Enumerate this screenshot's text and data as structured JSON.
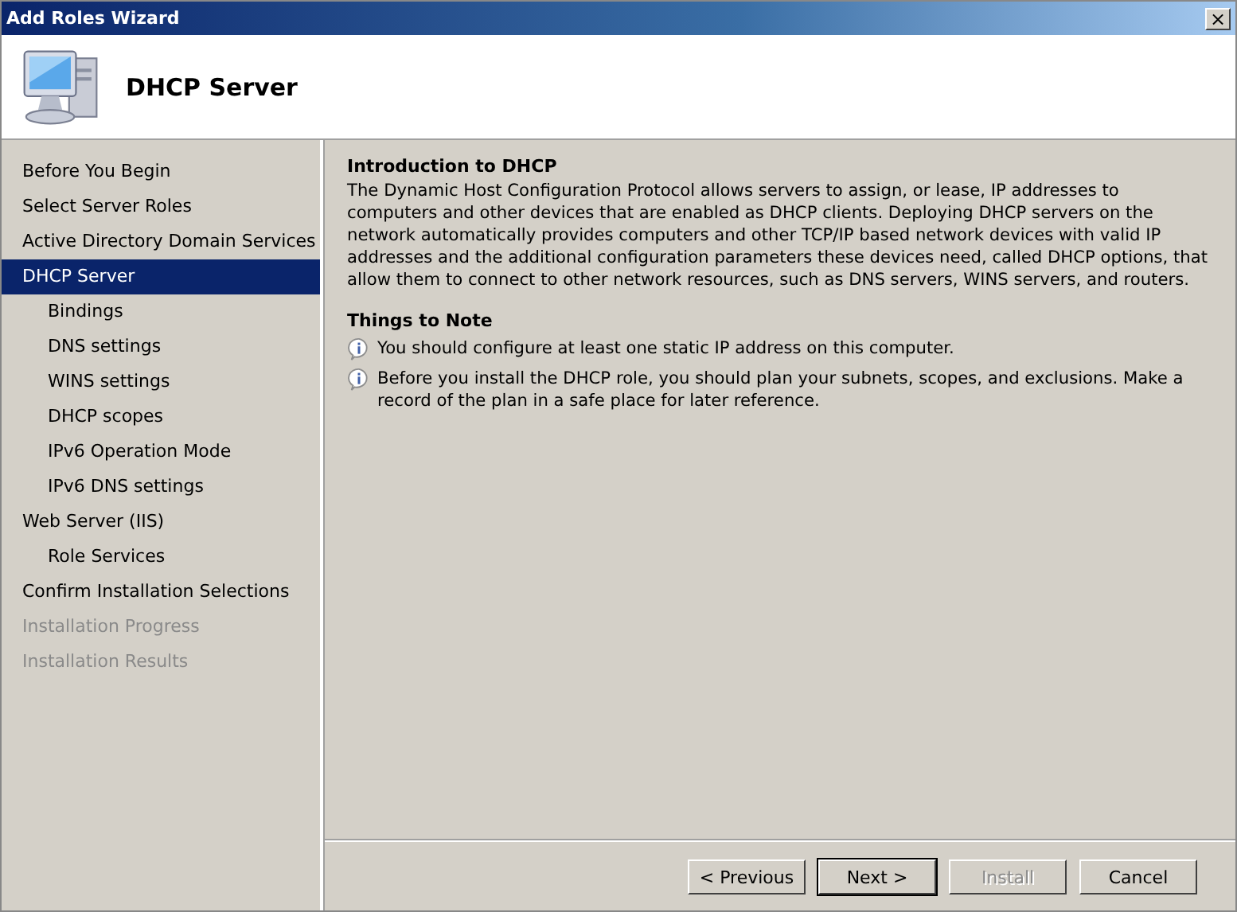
{
  "window": {
    "title": "Add Roles Wizard",
    "close": "×"
  },
  "header": {
    "title": "DHCP Server"
  },
  "steps": [
    {
      "label": "Before You Begin",
      "selected": false,
      "disabled": false
    },
    {
      "label": "Select Server Roles",
      "selected": false,
      "disabled": false
    },
    {
      "label": "Active Directory Domain Services",
      "selected": false,
      "disabled": false
    },
    {
      "label": "DHCP Server",
      "selected": true,
      "disabled": false,
      "children": [
        {
          "label": "Bindings",
          "selected": false,
          "disabled": false
        },
        {
          "label": "DNS settings",
          "selected": false,
          "disabled": false
        },
        {
          "label": "WINS settings",
          "selected": false,
          "disabled": false
        },
        {
          "label": "DHCP scopes",
          "selected": false,
          "disabled": false
        },
        {
          "label": "IPv6 Operation Mode",
          "selected": false,
          "disabled": false
        },
        {
          "label": "IPv6 DNS settings",
          "selected": false,
          "disabled": false
        }
      ]
    },
    {
      "label": "Web Server (IIS)",
      "selected": false,
      "disabled": false,
      "children": [
        {
          "label": "Role Services",
          "selected": false,
          "disabled": false
        }
      ]
    },
    {
      "label": "Confirm Installation Selections",
      "selected": false,
      "disabled": false
    },
    {
      "label": "Installation Progress",
      "selected": false,
      "disabled": true
    },
    {
      "label": "Installation Results",
      "selected": false,
      "disabled": true
    }
  ],
  "content": {
    "intro_heading": "Introduction to DHCP",
    "intro_text": "The Dynamic Host Configuration Protocol allows servers to assign, or lease, IP addresses to computers and other devices that are enabled as DHCP clients. Deploying DHCP servers on the network automatically provides computers and other TCP/IP based network devices with valid IP addresses and the additional configuration parameters these devices need, called DHCP options, that allow them to connect to other network resources, such as DNS servers, WINS servers, and routers.",
    "notes_heading": "Things to Note",
    "notes": [
      "You should configure at least one static IP address on this computer.",
      "Before you install the DHCP role, you should plan your subnets, scopes, and exclusions. Make a record of the plan in a safe place for later reference."
    ]
  },
  "buttons": [
    {
      "label": "< Previous",
      "disabled": false,
      "default": false
    },
    {
      "label": "Next >",
      "disabled": false,
      "default": true
    },
    {
      "label": "Install",
      "disabled": true,
      "default": false
    },
    {
      "label": "Cancel",
      "disabled": false,
      "default": false
    }
  ]
}
